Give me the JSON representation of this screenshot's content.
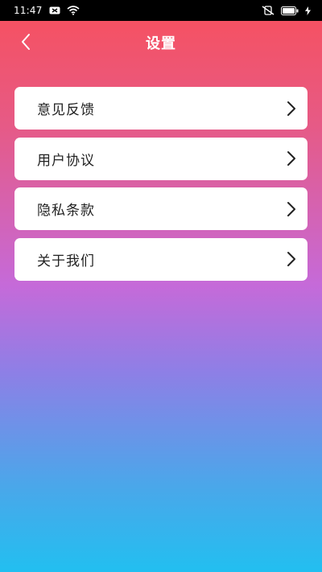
{
  "status_bar": {
    "time": "11:47",
    "icons": [
      "notification-icon",
      "wifi-icon",
      "mute-icon",
      "battery-icon",
      "charging-icon"
    ]
  },
  "nav": {
    "title": "设置",
    "back_icon": "chevron-left-icon"
  },
  "menu": {
    "items": [
      {
        "label": "意见反馈",
        "icon": "chevron-right-icon"
      },
      {
        "label": "用户协议",
        "icon": "chevron-right-icon"
      },
      {
        "label": "隐私条款",
        "icon": "chevron-right-icon"
      },
      {
        "label": "关于我们",
        "icon": "chevron-right-icon"
      }
    ]
  },
  "colors": {
    "gradient_top": "#f8505c",
    "gradient_mid": "#c56ad9",
    "gradient_bottom": "#22bff0",
    "card_bg": "#ffffff",
    "text": "#222222"
  }
}
